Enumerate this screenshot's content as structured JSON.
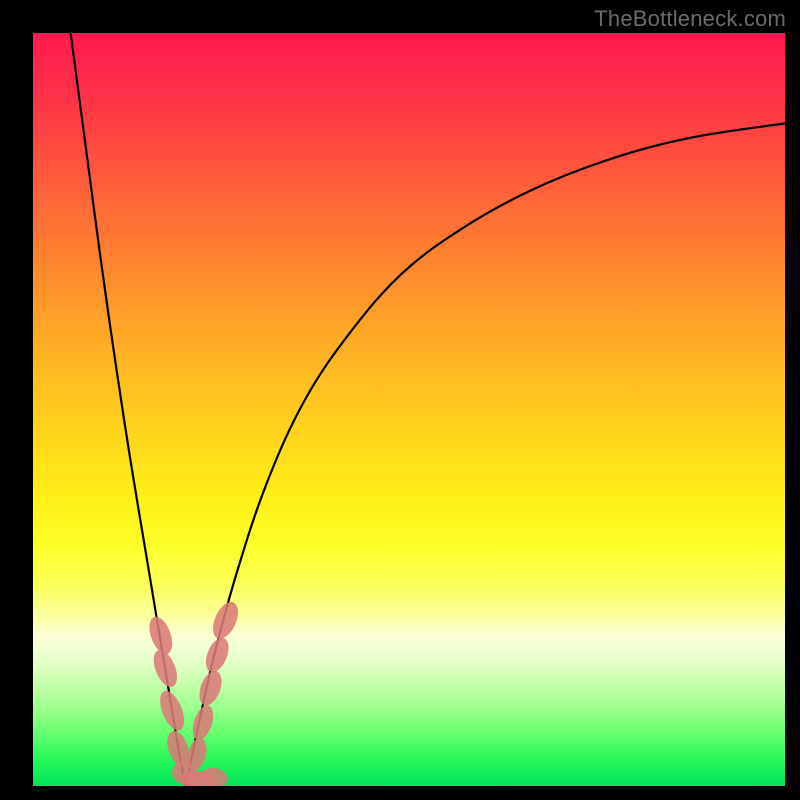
{
  "watermark": "TheBottleneck.com",
  "colors": {
    "frame": "#000000",
    "curve": "#000000",
    "marker": "#d97b77"
  },
  "chart_data": {
    "type": "line",
    "title": "",
    "xlabel": "",
    "ylabel": "",
    "xlim": [
      0,
      100
    ],
    "ylim": [
      0,
      100
    ],
    "grid": false,
    "legend": false,
    "series": [
      {
        "name": "left-branch",
        "x": [
          5,
          7,
          9,
          11,
          13,
          15,
          17,
          18.5,
          19.5,
          20.3
        ],
        "y": [
          100,
          85,
          70,
          56,
          43,
          31,
          19,
          10,
          4,
          0
        ]
      },
      {
        "name": "right-branch",
        "x": [
          20.3,
          22,
          24,
          27,
          31,
          36,
          42,
          49,
          57,
          66,
          76,
          87,
          100
        ],
        "y": [
          0,
          8,
          17,
          28,
          40,
          51,
          60,
          68,
          74,
          79,
          83,
          86,
          88
        ]
      }
    ],
    "markers": [
      {
        "cx": 17.0,
        "cy": 20.0,
        "rx": 1.3,
        "ry": 2.6,
        "rot": -20
      },
      {
        "cx": 17.6,
        "cy": 15.6,
        "rx": 1.3,
        "ry": 2.6,
        "rot": -22
      },
      {
        "cx": 18.5,
        "cy": 10.0,
        "rx": 1.3,
        "ry": 2.8,
        "rot": -22
      },
      {
        "cx": 19.3,
        "cy": 5.0,
        "rx": 1.3,
        "ry": 2.4,
        "rot": -18
      },
      {
        "cx": 20.0,
        "cy": 1.8,
        "rx": 1.5,
        "ry": 1.5,
        "rot": 0
      },
      {
        "cx": 21.0,
        "cy": 0.9,
        "rx": 1.4,
        "ry": 1.2,
        "rot": 0
      },
      {
        "cx": 22.4,
        "cy": 0.8,
        "rx": 1.8,
        "ry": 1.2,
        "rot": 0
      },
      {
        "cx": 24.1,
        "cy": 1.1,
        "rx": 1.8,
        "ry": 1.3,
        "rot": 12
      },
      {
        "cx": 23.6,
        "cy": 13.0,
        "rx": 1.3,
        "ry": 2.4,
        "rot": 20
      },
      {
        "cx": 24.5,
        "cy": 17.4,
        "rx": 1.3,
        "ry": 2.4,
        "rot": 22
      },
      {
        "cx": 25.6,
        "cy": 22.0,
        "rx": 1.4,
        "ry": 2.6,
        "rot": 24
      },
      {
        "cx": 22.6,
        "cy": 8.4,
        "rx": 1.2,
        "ry": 2.4,
        "rot": 18
      },
      {
        "cx": 21.8,
        "cy": 4.2,
        "rx": 1.2,
        "ry": 2.2,
        "rot": 14
      }
    ]
  }
}
